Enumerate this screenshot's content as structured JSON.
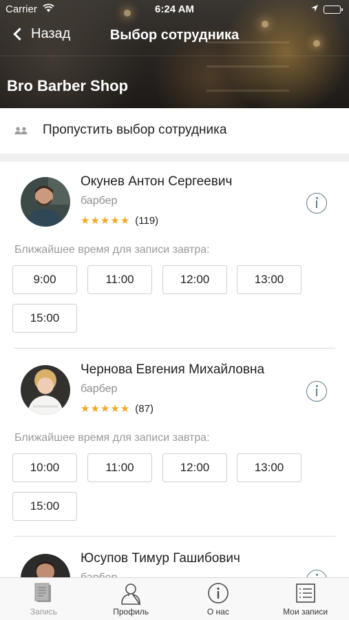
{
  "status_bar": {
    "carrier": "Carrier",
    "time": "6:24 AM"
  },
  "nav": {
    "back_label": "Назад",
    "title": "Выбор сотрудника"
  },
  "shop_name": "Bro Barber Shop",
  "skip": {
    "label": "Пропустить выбор сотрудника"
  },
  "employees": [
    {
      "name": "Окунев Антон Сергеевич",
      "role": "барбер",
      "stars": 5,
      "reviews": "(119)",
      "hint": "Ближайшее время для записи завтра:",
      "slots": [
        "9:00",
        "11:00",
        "12:00",
        "13:00",
        "15:00"
      ]
    },
    {
      "name": "Чернова Евгения Михайловна",
      "role": "барбер",
      "stars": 5,
      "reviews": "(87)",
      "hint": "Ближайшее время для записи завтра:",
      "slots": [
        "10:00",
        "11:00",
        "12:00",
        "13:00",
        "15:00"
      ]
    },
    {
      "name": "Юсупов Тимур Гашибович",
      "role": "барбер"
    }
  ],
  "tabbar": {
    "tabs": [
      {
        "label": "Запись",
        "icon": "booking-icon",
        "state": "disabled"
      },
      {
        "label": "Профиль",
        "icon": "profile-icon",
        "state": "normal"
      },
      {
        "label": "О нас",
        "icon": "info-icon",
        "state": "normal"
      },
      {
        "label": "Мои записи",
        "icon": "list-icon",
        "state": "normal"
      }
    ]
  },
  "colors": {
    "star": "#f5a623",
    "info_icon": "#5f7b8a",
    "tab_icon": "#4a4a4a"
  }
}
